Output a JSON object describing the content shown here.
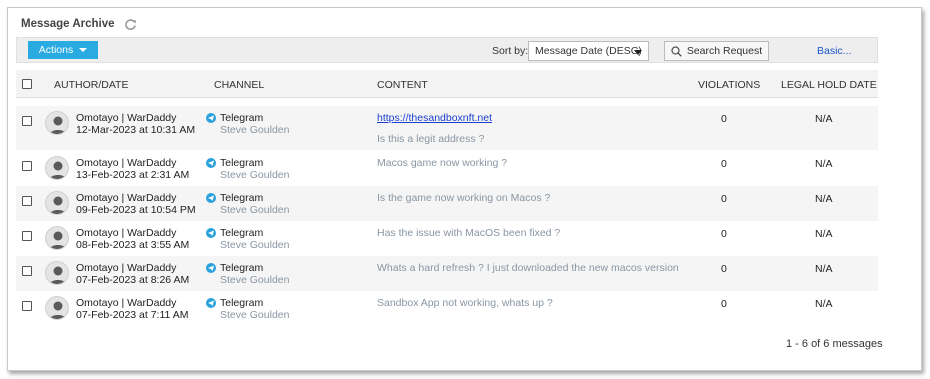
{
  "title": "Message Archive",
  "toolbar": {
    "actions_label": "Actions",
    "sort_by_label": "Sort by:",
    "sort_value": "Message Date (DESC)",
    "search_label": "Search Request",
    "basic_label": "Basic..."
  },
  "columns": {
    "author": "AUTHOR/DATE",
    "channel": "CHANNEL",
    "content": "CONTENT",
    "violations": "VIOLATIONS",
    "legal_hold": "LEGAL HOLD DATE"
  },
  "rows": [
    {
      "author": "Omotayo | WarDaddy",
      "date": "12-Mar-2023 at 10:31 AM",
      "channel": "Telegram",
      "sender": "Steve Goulden",
      "link": "https://thesandboxnft.net",
      "content": "Is this a legit address ?",
      "violations": "0",
      "legal_hold": "N/A"
    },
    {
      "author": "Omotayo | WarDaddy",
      "date": "13-Feb-2023 at 2:31 AM",
      "channel": "Telegram",
      "sender": "Steve Goulden",
      "content": "Macos game now working ?",
      "violations": "0",
      "legal_hold": "N/A"
    },
    {
      "author": "Omotayo | WarDaddy",
      "date": "09-Feb-2023 at 10:54 PM",
      "channel": "Telegram",
      "sender": "Steve Goulden",
      "content": "Is the game now working on Macos ?",
      "violations": "0",
      "legal_hold": "N/A"
    },
    {
      "author": "Omotayo | WarDaddy",
      "date": "08-Feb-2023 at 3:55 AM",
      "channel": "Telegram",
      "sender": "Steve Goulden",
      "content": "Has the issue with MacOS been fixed ?",
      "violations": "0",
      "legal_hold": "N/A"
    },
    {
      "author": "Omotayo | WarDaddy",
      "date": "07-Feb-2023 at 8:26 AM",
      "channel": "Telegram",
      "sender": "Steve Goulden",
      "content": "Whats a hard refresh ? I just downloaded the new macos version",
      "violations": "0",
      "legal_hold": "N/A"
    },
    {
      "author": "Omotayo | WarDaddy",
      "date": "07-Feb-2023 at 7:11 AM",
      "channel": "Telegram",
      "sender": "Steve Goulden",
      "content": "Sandbox App not working, whats up ?",
      "violations": "0",
      "legal_hold": "N/A"
    }
  ],
  "pagination": "1 - 6 of 6 messages",
  "icons": {
    "refresh": "refresh-icon",
    "search": "search-icon",
    "avatar": "user-avatar-icon",
    "channel": "telegram-icon"
  },
  "colors": {
    "accent": "#29abe2",
    "link": "#1a3fcc",
    "muted": "#8a96a3",
    "telegram": "#2aa1dc"
  }
}
